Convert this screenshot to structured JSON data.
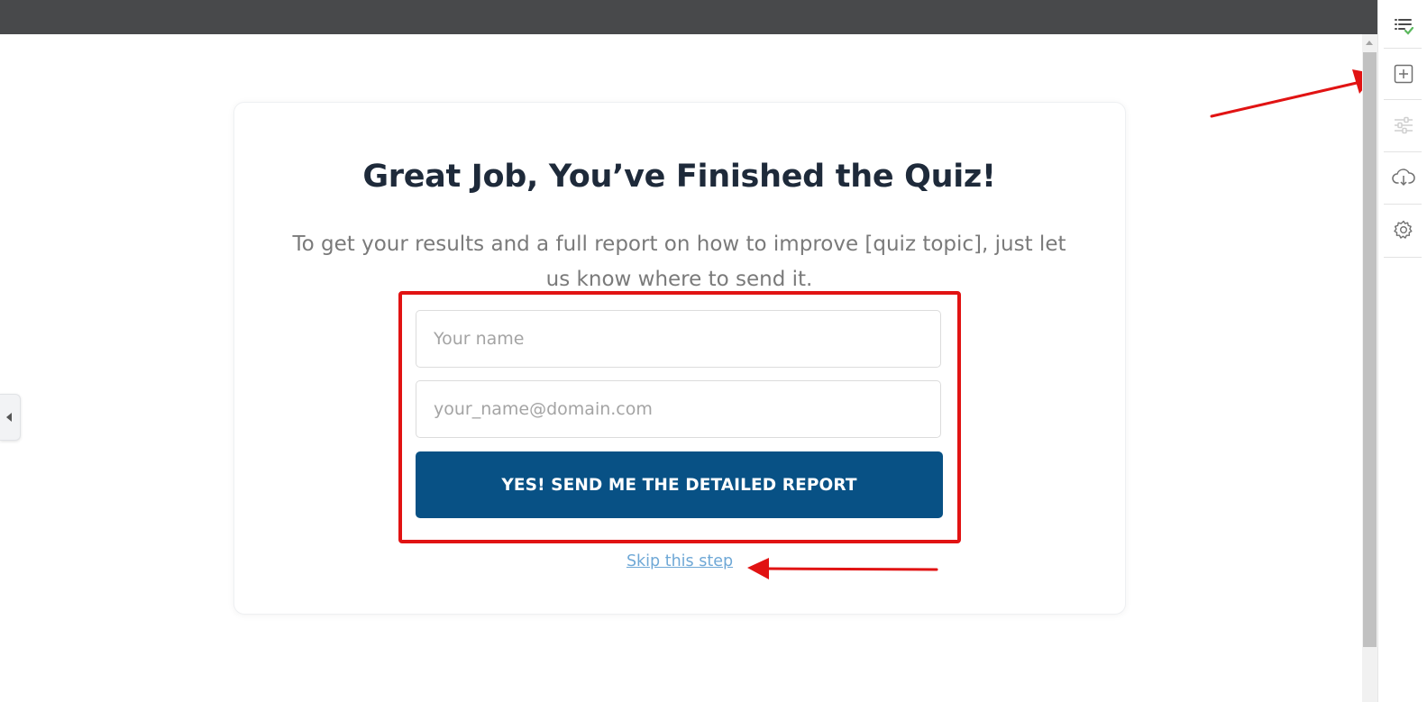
{
  "quiz": {
    "title": "Great Job, You’ve Finished the Quiz!",
    "subtitle": "To get your results and a full report on how to improve [quiz topic], just let us know where to send it.",
    "name_placeholder": "Your name",
    "email_placeholder": "your_name@domain.com",
    "submit_label": "YES! SEND ME THE DETAILED REPORT",
    "skip_label": "Skip this step"
  },
  "toolbar": {
    "items": [
      "list-check-icon",
      "add-element-icon",
      "sliders-icon",
      "cloud-download-icon",
      "gear-icon"
    ]
  },
  "colors": {
    "topbar": "#48494b",
    "button": "#085185",
    "annotation": "#e11313",
    "link": "#6fa8d6"
  }
}
